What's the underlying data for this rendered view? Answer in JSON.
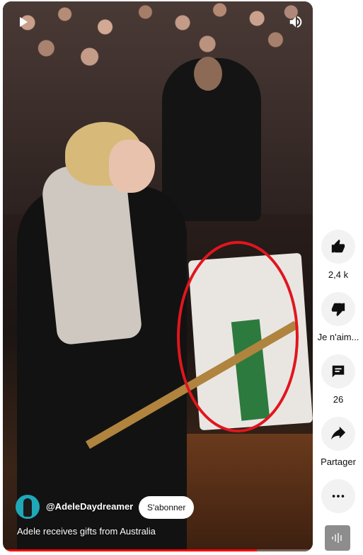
{
  "video": {
    "channel_handle": "@AdeleDaydreamer",
    "subscribe_label": "S'abonner",
    "title": "Adele receives gifts from Australia",
    "progress": 0.82
  },
  "actions": {
    "like": {
      "icon": "thumbs-up-icon",
      "label": "2,4 k"
    },
    "dislike": {
      "icon": "thumbs-down-icon",
      "label": "Je n'aim..."
    },
    "comments": {
      "icon": "comment-icon",
      "label": "26"
    },
    "share": {
      "icon": "share-icon",
      "label": "Partager"
    },
    "more": {
      "icon": "more-icon"
    },
    "sound": {
      "icon": "audio-waveform-icon"
    }
  },
  "colors": {
    "annotation_circle": "#e0161e",
    "progress": "#ff0000",
    "action_bg": "#f2f2f2"
  }
}
